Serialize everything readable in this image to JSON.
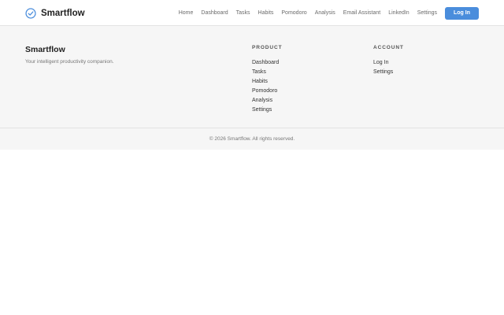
{
  "header": {
    "brand_name": "Smartflow",
    "brand_icon": "check-circle-icon",
    "accent_color": "#4a8ddc",
    "nav_links": [
      "Home",
      "Dashboard",
      "Tasks",
      "Habits",
      "Pomodoro",
      "Analysis",
      "Email Assistant",
      "LinkedIn",
      "Settings"
    ],
    "login_label": "Log In"
  },
  "footer": {
    "brand_title": "Smartflow",
    "tagline": "Your intelligent productivity companion.",
    "product": {
      "heading": "PRODUCT",
      "links": [
        "Dashboard",
        "Tasks",
        "Habits",
        "Pomodoro",
        "Analysis",
        "Settings"
      ]
    },
    "account": {
      "heading": "ACCOUNT",
      "links": [
        "Log In",
        "Settings"
      ]
    },
    "copyright": "© 2026 Smartflow. All rights reserved."
  }
}
